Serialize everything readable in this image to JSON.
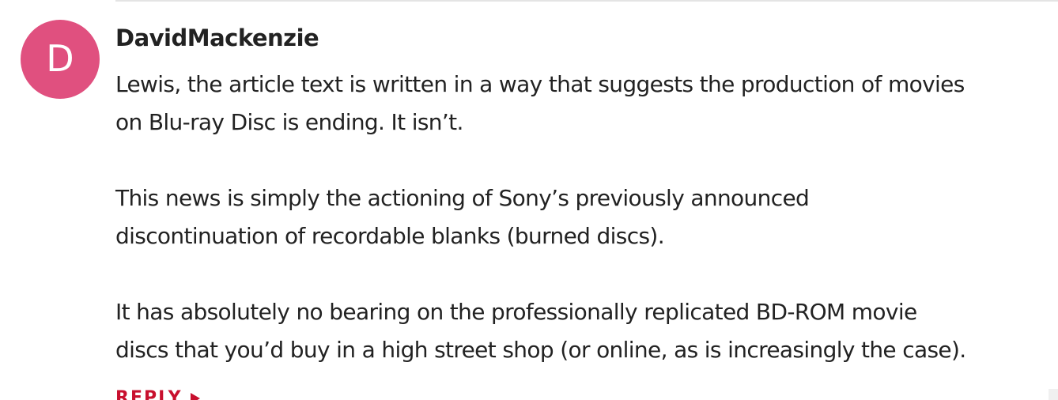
{
  "comment": {
    "avatar_letter": "D",
    "author": "DavidMackenzie",
    "paragraphs": [
      [
        "Lewis, the article text is written in a way that suggests the production of movies",
        "on Blu-ray Disc is ending. It isn’t."
      ],
      [
        "This news is simply the actioning of Sony’s previously announced",
        "discontinuation of recordable blanks (burned discs)."
      ],
      [
        "It has absolutely no bearing on the professionally replicated BD-ROM movie",
        "discs that you’d buy in a high street shop (or online, as is increasingly the case)."
      ]
    ],
    "reply_label": "REPLY"
  },
  "colors": {
    "avatar_bg": "#e0507f",
    "reply_accent": "#c8102e",
    "text": "#222222"
  }
}
